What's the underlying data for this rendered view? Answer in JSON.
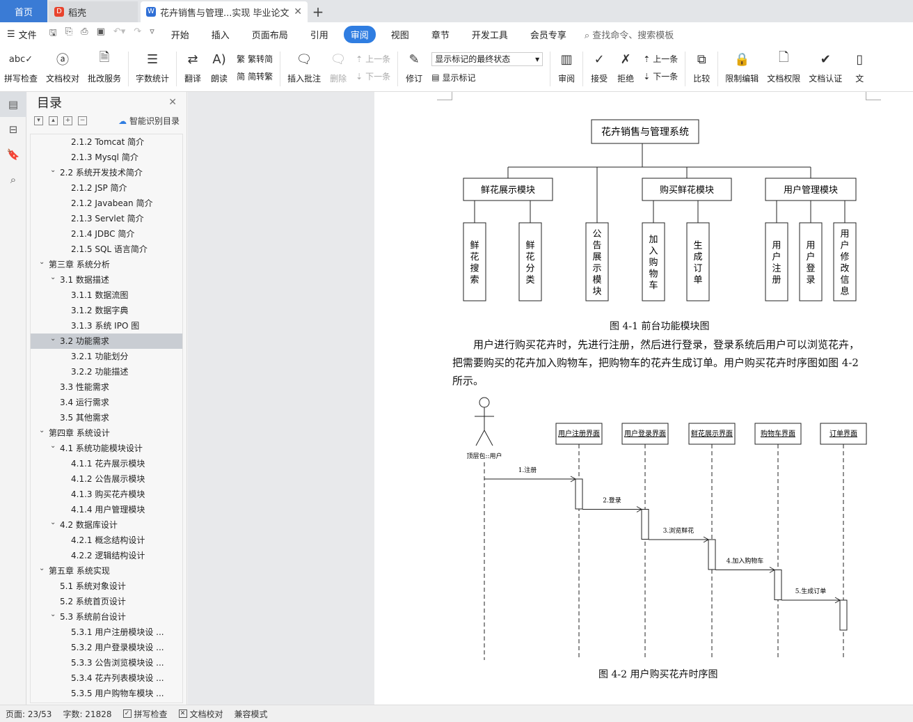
{
  "tabs": {
    "home": "首页",
    "draft": "稻壳",
    "document": "花卉销售与管理...实现 毕业论文"
  },
  "menubar": {
    "file": "文件",
    "items": [
      "开始",
      "插入",
      "页面布局",
      "引用",
      "审阅",
      "视图",
      "章节",
      "开发工具",
      "会员专享"
    ],
    "active": "审阅",
    "search": "查找命令、搜索模板"
  },
  "ribbon": {
    "spell": "拼写检查",
    "proof": "文档校对",
    "annot_service": "批改服务",
    "wordcount": "字数统计",
    "translate": "翻译",
    "read": "朗读",
    "trad": "繁转简",
    "simp": "简转繁",
    "insert_comment": "插入批注",
    "delete": "删除",
    "prev": "上一条",
    "next": "下一条",
    "revise": "修订",
    "markup_combo": "显示标记的最终状态",
    "show_markup": "显示标记",
    "review": "审阅",
    "accept": "接受",
    "reject": "拒绝",
    "prev2": "上一条",
    "next2": "下一条",
    "compare": "比较",
    "restrict": "限制编辑",
    "permission": "文档权限",
    "auth": "文档认证",
    "more": "文"
  },
  "toc": {
    "title": "目录",
    "smart": "智能识别目录",
    "items": [
      {
        "text": "2.1.2 Tomcat 简介",
        "level": 3
      },
      {
        "text": "2.1.3 Mysql 简介",
        "level": 3
      },
      {
        "text": "2.2 系统开发技术简介",
        "level": 2,
        "arrow": true
      },
      {
        "text": "2.1.2 JSP 简介",
        "level": 3
      },
      {
        "text": "2.1.2 Javabean 简介",
        "level": 3
      },
      {
        "text": "2.1.3 Servlet 简介",
        "level": 3
      },
      {
        "text": "2.1.4 JDBC 简介",
        "level": 3
      },
      {
        "text": "2.1.5 SQL 语言简介",
        "level": 3
      },
      {
        "text": "第三章     系统分析",
        "level": 1,
        "arrow": true
      },
      {
        "text": "3.1 数据描述",
        "level": 2,
        "arrow": true
      },
      {
        "text": "3.1.1 数据流图",
        "level": 3
      },
      {
        "text": "3.1.2 数据字典",
        "level": 3
      },
      {
        "text": "3.1.3 系统 IPO 图",
        "level": 3
      },
      {
        "text": "3.2 功能需求",
        "level": 2,
        "arrow": true,
        "selected": true
      },
      {
        "text": "3.2.1 功能划分",
        "level": 3
      },
      {
        "text": "3.2.2 功能描述",
        "level": 3
      },
      {
        "text": "3.3 性能需求",
        "level": 2
      },
      {
        "text": "3.4 运行需求",
        "level": 2
      },
      {
        "text": "3.5 其他需求",
        "level": 2
      },
      {
        "text": "第四章     系统设计",
        "level": 1,
        "arrow": true
      },
      {
        "text": "4.1 系统功能模块设计",
        "level": 2,
        "arrow": true
      },
      {
        "text": "4.1.1 花卉展示模块",
        "level": 3
      },
      {
        "text": "4.1.2 公告展示模块",
        "level": 3
      },
      {
        "text": "4.1.3 购买花卉模块",
        "level": 3
      },
      {
        "text": "4.1.4 用户管理模块",
        "level": 3
      },
      {
        "text": "4.2 数据库设计",
        "level": 2,
        "arrow": true
      },
      {
        "text": "4.2.1 概念结构设计",
        "level": 3
      },
      {
        "text": "4.2.2 逻辑结构设计",
        "level": 3
      },
      {
        "text": "第五章     系统实现",
        "level": 1,
        "arrow": true
      },
      {
        "text": "5.1 系统对象设计",
        "level": 2
      },
      {
        "text": "5.2 系统首页设计",
        "level": 2
      },
      {
        "text": "5.3 系统前台设计",
        "level": 2,
        "arrow": true
      },
      {
        "text": "5.3.1 用户注册模块设 ...",
        "level": 3
      },
      {
        "text": "5.3.2 用户登录模块设 ...",
        "level": 3
      },
      {
        "text": "5.3.3 公告浏览模块设 ...",
        "level": 3
      },
      {
        "text": "5.3.4 花卉列表模块设 ...",
        "level": 3
      },
      {
        "text": "5.3.5 用户购物车模块 ...",
        "level": 3
      }
    ]
  },
  "doc": {
    "fig1": {
      "root": "花卉销售与管理系统",
      "modules": [
        "鲜花展示模块",
        "购买鲜花模块",
        "用户管理模块"
      ],
      "leaves": [
        "鲜花搜索",
        "鲜花分类",
        "公告展示模块",
        "加入购物车",
        "生成订单",
        "用户注册",
        "用户登录",
        "用户修改信息"
      ],
      "caption": "图 4-1 前台功能模块图"
    },
    "paragraph": "用户进行购买花卉时，先进行注册，然后进行登录，登录系统后用户可以浏览花卉，把需要购买的花卉加入购物车，把购物车的花卉生成订单。用户购买花卉时序图如图 4-2 所示。",
    "fig2": {
      "actor": "顶层包::用户",
      "lifelines": [
        "用户注册界面",
        "用户登录界面",
        "鲜花展示界面",
        "购物车界面",
        "订单界面"
      ],
      "messages": [
        "1.注册",
        "2.登录",
        "3.浏览鲜花",
        "4.加入购物车",
        "5.生成订单"
      ],
      "caption": "图 4-2    用户购买花卉时序图"
    }
  },
  "status": {
    "page": "页面: 23/53",
    "words": "字数: 21828",
    "spell": "拼写检查",
    "proof": "文档校对",
    "compat": "兼容模式"
  }
}
